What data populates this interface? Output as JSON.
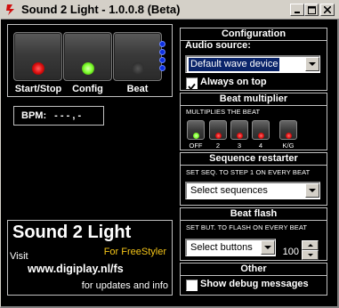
{
  "window": {
    "title": "Sound 2 Light - 1.0.0.8 (Beta)"
  },
  "controls": {
    "buttons": [
      {
        "label": "Start/Stop",
        "led": "#e01010"
      },
      {
        "label": "Config",
        "led": "#7cff2a"
      },
      {
        "label": "Beat",
        "led": "#3a3a3a"
      }
    ],
    "bpm_label": "BPM:",
    "bpm_value": "- - - , -"
  },
  "about": {
    "title": "Sound 2 Light",
    "subtitle": "For FreeStyler",
    "visit": "Visit",
    "url": "www.digiplay.nl/fs",
    "note": "for updates and info"
  },
  "configuration": {
    "header": "Configuration",
    "audio_source_label": "Audio source:",
    "audio_source_value": "Default wave device",
    "always_on_top_label": "Always on top",
    "always_on_top": true
  },
  "beat_multiplier": {
    "header": "Beat multiplier",
    "caption": "MULTIPLIES THE BEAT",
    "options": [
      {
        "label": "OFF",
        "led": "#7cff2a"
      },
      {
        "label": "2",
        "led": "#e01010"
      },
      {
        "label": "3",
        "led": "#e01010"
      },
      {
        "label": "4",
        "led": "#e01010"
      },
      {
        "label": "K/G",
        "led": "#e01010"
      }
    ]
  },
  "sequence_restarter": {
    "header": "Sequence restarter",
    "caption": "SET SEQ. TO STEP 1 ON EVERY BEAT",
    "select_value": "Select sequences"
  },
  "beat_flash": {
    "header": "Beat flash",
    "caption": "SET BUT. TO FLASH ON EVERY BEAT",
    "select_value": "Select buttons",
    "amount": "100"
  },
  "other": {
    "header": "Other",
    "debug_label": "Show debug messages",
    "debug": false
  }
}
